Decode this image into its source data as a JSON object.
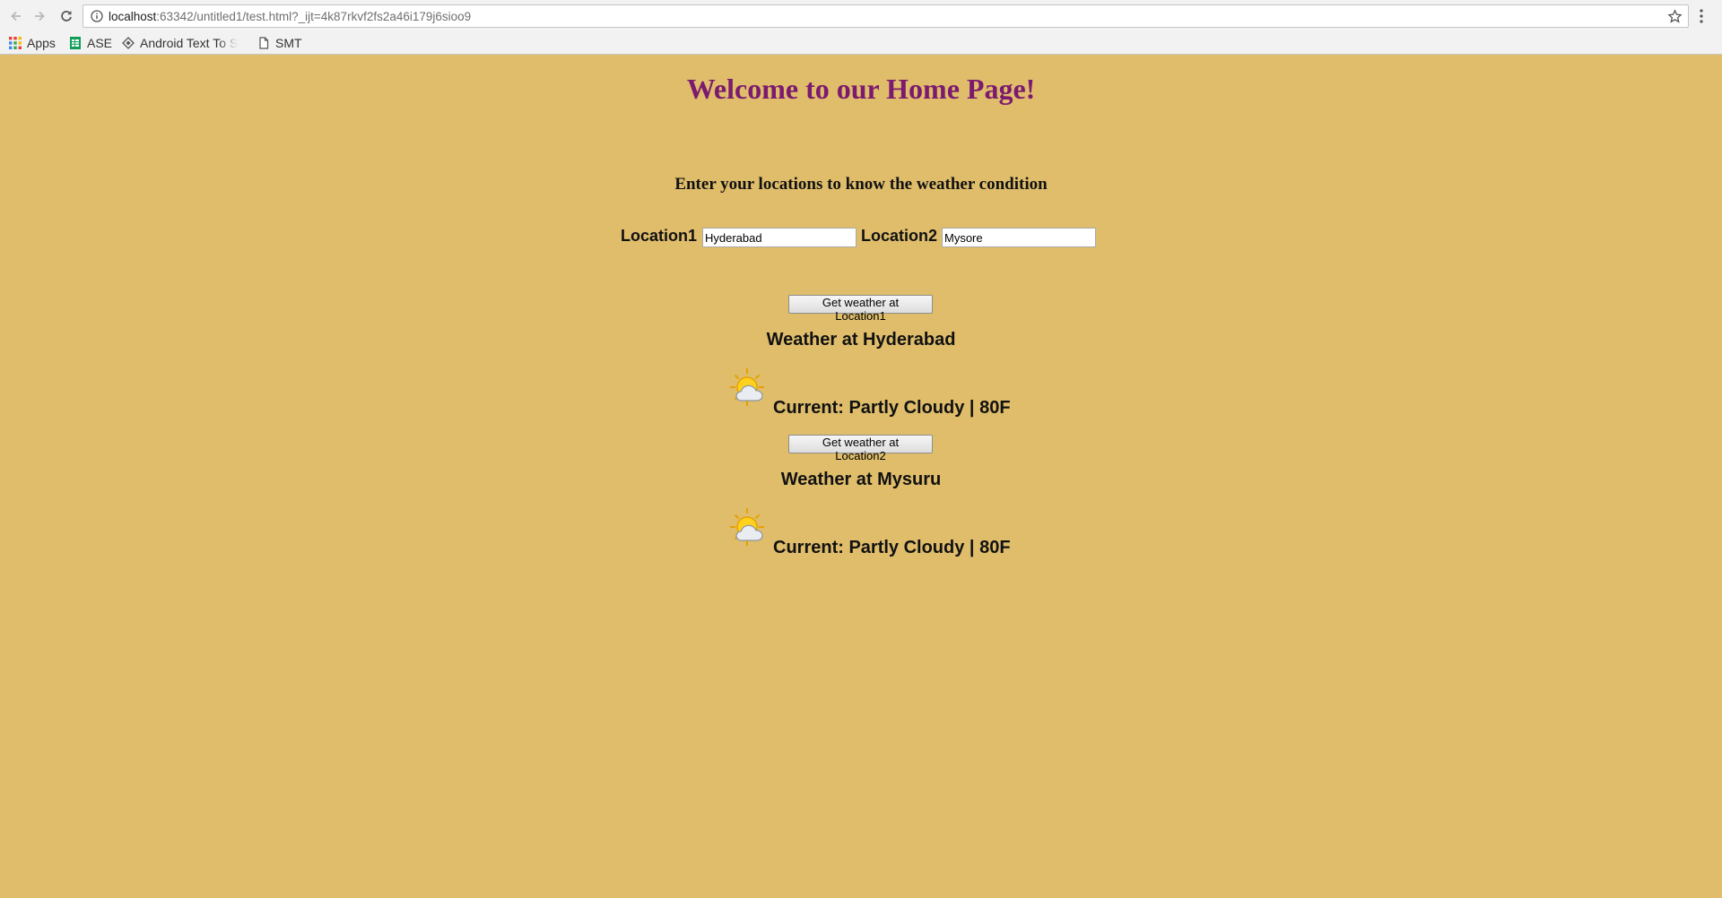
{
  "browser": {
    "url_host": "localhost",
    "url_rest": ":63342/untitled1/test.html?_ijt=4k87rkvf2fs2a46i179j6sioo9",
    "bookmarks": [
      {
        "label": "Apps",
        "icon": "apps-grid-icon"
      },
      {
        "label": "ASE",
        "icon": "sheets-icon"
      },
      {
        "label": "Android Text To S",
        "icon": "diamond-icon"
      },
      {
        "label": "SMT",
        "icon": "page-icon"
      }
    ]
  },
  "page": {
    "title": "Welcome to our Home Page!",
    "subtitle": "Enter your locations to know the weather condition",
    "location1_label": "Location1 :",
    "location1_value": "Hyderabad",
    "location2_label": "Location2 :",
    "location2_value": "Mysore",
    "weather": [
      {
        "button": "Get weather at Location1",
        "heading": "Weather at Hyderabad",
        "current": "Current: Partly Cloudy | 80F",
        "icon": "partly-cloudy-icon"
      },
      {
        "button": "Get weather at Location2",
        "heading": "Weather at Mysuru",
        "current": "Current: Partly Cloudy | 80F",
        "icon": "partly-cloudy-icon"
      }
    ]
  },
  "colors": {
    "background": "#dfbd6b",
    "title": "#7b1a6e"
  }
}
